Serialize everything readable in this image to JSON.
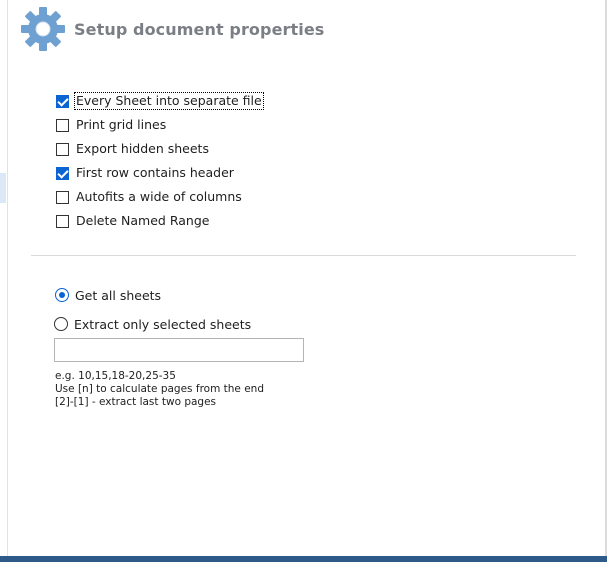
{
  "header": {
    "title": "Setup document properties",
    "icon": "gear-icon"
  },
  "options": [
    {
      "label": "Every Sheet into separate file",
      "checked": true,
      "focused": true
    },
    {
      "label": "Print grid lines",
      "checked": false
    },
    {
      "label": "Export hidden sheets",
      "checked": false
    },
    {
      "label": "First row contains header",
      "checked": true
    },
    {
      "label": "Autofits a wide of columns",
      "checked": false
    },
    {
      "label": "Delete Named Range",
      "checked": false
    }
  ],
  "sheets": {
    "selected": "all",
    "all_label": "Get all sheets",
    "selected_label": "Extract only selected sheets",
    "input_value": ""
  },
  "hints": [
    "e.g. 10,15,18-20,25-35",
    "Use [n] to calculate pages from the end",
    "[2]-[1] - extract last two pages"
  ],
  "colors": {
    "accent": "#0a64d2",
    "gear": "#6fa0d2",
    "title": "#7b7f85",
    "bottom_bar": "#2e5a8a"
  }
}
